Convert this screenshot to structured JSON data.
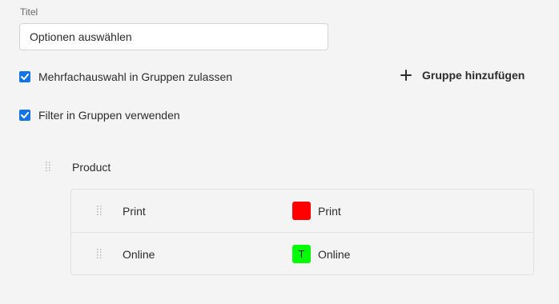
{
  "title_field": {
    "label": "Titel",
    "value": "Optionen auswählen"
  },
  "options": {
    "multi_select": {
      "label": "Mehrfachauswahl in Gruppen zulassen",
      "checked": true
    },
    "use_filter": {
      "label": "Filter in Gruppen verwenden",
      "checked": true
    },
    "add_group_label": "Gruppe hinzufügen"
  },
  "group": {
    "name": "Product",
    "items": [
      {
        "name": "Print",
        "swatch_text": "",
        "swatch_color": "#ff0000",
        "label": "Print"
      },
      {
        "name": "Online",
        "swatch_text": "T",
        "swatch_color": "#00ff00",
        "label": "Online"
      }
    ]
  },
  "colors": {
    "accent": "#1473e6",
    "background": "#f4f4f4"
  }
}
